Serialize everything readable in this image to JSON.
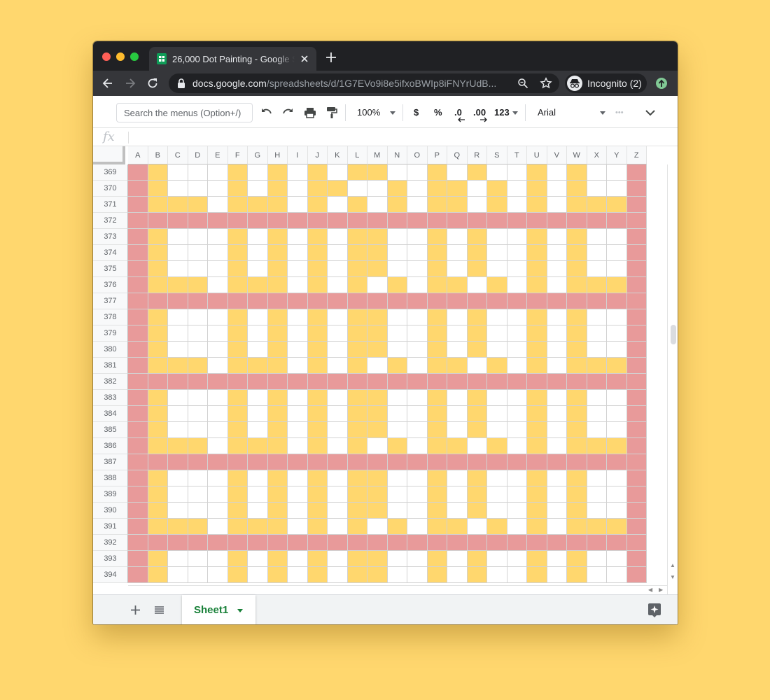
{
  "browser": {
    "tab_title": "26,000 Dot Painting - Google Sheets",
    "url_host": "docs.google.com",
    "url_path": "/spreadsheets/d/1G7EVo9i8e5ifxoBWIp8iFNYrUdB...",
    "profile_label": "Incognito (2)"
  },
  "sheets_toolbar": {
    "menu_search_placeholder": "Search the menus (Option+/)",
    "zoom": "100%",
    "currency": "$",
    "percent": "%",
    "decrease_decimals": ".0",
    "increase_decimals": ".00",
    "more_formats": "123",
    "font": "Arial",
    "more": "•••"
  },
  "formula_bar": {
    "label": "fx"
  },
  "grid": {
    "columns": [
      "A",
      "B",
      "C",
      "D",
      "E",
      "F",
      "G",
      "H",
      "I",
      "J",
      "K",
      "L",
      "M",
      "N",
      "O",
      "P",
      "Q",
      "R",
      "S",
      "T",
      "U",
      "V",
      "W",
      "X",
      "Y",
      "Z"
    ],
    "rows": [
      "369",
      "370",
      "371",
      "372",
      "373",
      "374",
      "375",
      "376",
      "377",
      "378",
      "379",
      "380",
      "381",
      "382",
      "383",
      "384",
      "385",
      "386",
      "387",
      "388",
      "389",
      "390",
      "391",
      "392",
      "393",
      "394"
    ],
    "colors": {
      "pink": "#E89A9A",
      "yellow": "#FFD76E",
      "white": "#FFFFFF"
    },
    "pattern_rows": [
      "PYWWWYWYWYWYYWWYWYWWYWYWWP",
      "PYWWWYWYWYYWWYWYYWYWYWYWWP",
      "PYYYWYYYWYWYWYWYYWYWYWYYYP",
      "PPPPPPPPPPPPPPPPPPPPPPPPPP"
    ],
    "row_block": [
      0,
      1,
      2,
      3,
      0,
      0,
      0,
      2,
      3,
      0,
      0,
      0,
      2,
      3,
      0,
      0,
      0,
      2,
      3,
      0,
      0,
      0,
      2,
      3,
      0,
      0
    ]
  },
  "sheet_tabs": {
    "active": "Sheet1"
  }
}
